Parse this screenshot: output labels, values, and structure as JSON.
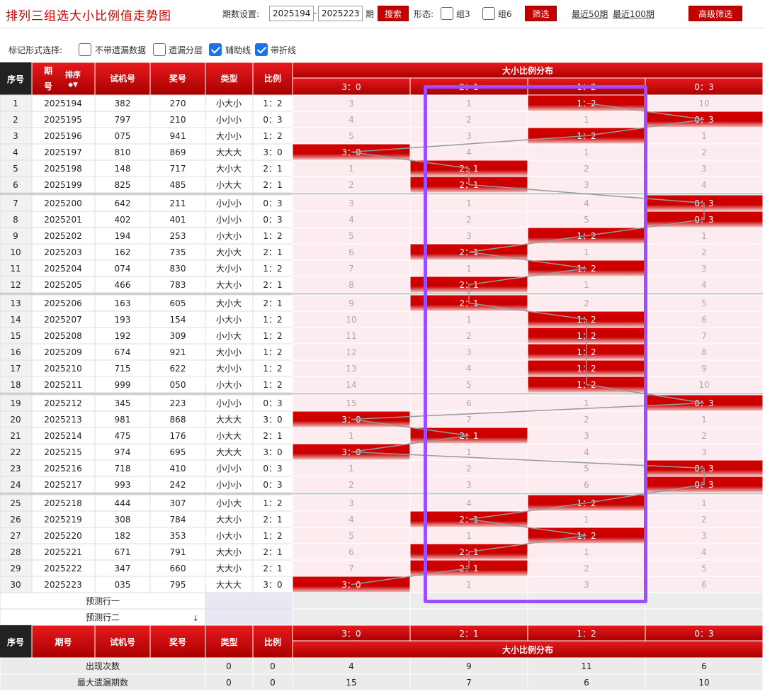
{
  "title": "排列三组选大小比例值走势图",
  "toolbar": {
    "period_label": "期数设置:",
    "from": "2025194",
    "dash": "-",
    "to": "2025223",
    "period_unit": "期",
    "search_label": "搜索",
    "shape_label": "形态:",
    "group3_label": "组3",
    "group6_label": "组6",
    "filter_label": "筛选",
    "recent50_label": "最近50期",
    "recent100_label": "最近100期",
    "advanced_label": "高级筛选"
  },
  "markbar": {
    "label": "标记形式选择:",
    "options": [
      {
        "label": "不带遗漏数据",
        "checked": false
      },
      {
        "label": "遗漏分层",
        "checked": false
      },
      {
        "label": "辅助线",
        "checked": true
      },
      {
        "label": "带折线",
        "checked": true
      }
    ]
  },
  "table": {
    "headers": {
      "seq": "序号",
      "period": "期号",
      "sort": "排序",
      "test": "试机号",
      "draw": "奖号",
      "type": "类型",
      "ratio": "比例",
      "dist": "大小比例分布"
    },
    "dist_columns": [
      "3：0",
      "2：1",
      "1：2",
      "0：3"
    ],
    "rows": [
      {
        "seq": "1",
        "period": "2025194",
        "test": "382",
        "draw": "270",
        "type": "小大小",
        "ratio": "1：2",
        "cells": [
          "3",
          "1",
          "1：2",
          "10"
        ],
        "hit": 2
      },
      {
        "seq": "2",
        "period": "2025195",
        "test": "797",
        "draw": "210",
        "type": "小小小",
        "ratio": "0：3",
        "cells": [
          "4",
          "2",
          "1",
          "0：3"
        ],
        "hit": 3
      },
      {
        "seq": "3",
        "period": "2025196",
        "test": "075",
        "draw": "941",
        "type": "大小小",
        "ratio": "1：2",
        "cells": [
          "5",
          "3",
          "1：2",
          "1"
        ],
        "hit": 2
      },
      {
        "seq": "4",
        "period": "2025197",
        "test": "810",
        "draw": "869",
        "type": "大大大",
        "ratio": "3：0",
        "cells": [
          "3：0",
          "4",
          "1",
          "2"
        ],
        "hit": 0
      },
      {
        "seq": "5",
        "period": "2025198",
        "test": "148",
        "draw": "717",
        "type": "大小大",
        "ratio": "2：1",
        "cells": [
          "1",
          "2：1",
          "2",
          "3"
        ],
        "hit": 1
      },
      {
        "seq": "6",
        "period": "2025199",
        "test": "825",
        "draw": "485",
        "type": "小大大",
        "ratio": "2：1",
        "cells": [
          "2",
          "2：1",
          "3",
          "4"
        ],
        "hit": 1
      },
      {
        "seq": "7",
        "period": "2025200",
        "test": "642",
        "draw": "211",
        "type": "小小小",
        "ratio": "0：3",
        "cells": [
          "3",
          "1",
          "4",
          "0：3"
        ],
        "hit": 3
      },
      {
        "seq": "8",
        "period": "2025201",
        "test": "402",
        "draw": "401",
        "type": "小小小",
        "ratio": "0：3",
        "cells": [
          "4",
          "2",
          "5",
          "0：3"
        ],
        "hit": 3
      },
      {
        "seq": "9",
        "period": "2025202",
        "test": "194",
        "draw": "253",
        "type": "小大小",
        "ratio": "1：2",
        "cells": [
          "5",
          "3",
          "1：2",
          "1"
        ],
        "hit": 2
      },
      {
        "seq": "10",
        "period": "2025203",
        "test": "162",
        "draw": "735",
        "type": "大小大",
        "ratio": "2：1",
        "cells": [
          "6",
          "2：1",
          "1",
          "2"
        ],
        "hit": 1
      },
      {
        "seq": "11",
        "period": "2025204",
        "test": "074",
        "draw": "830",
        "type": "大小小",
        "ratio": "1：2",
        "cells": [
          "7",
          "1",
          "1：2",
          "3"
        ],
        "hit": 2
      },
      {
        "seq": "12",
        "period": "2025205",
        "test": "466",
        "draw": "783",
        "type": "大大小",
        "ratio": "2：1",
        "cells": [
          "8",
          "2：1",
          "1",
          "4"
        ],
        "hit": 1
      },
      {
        "seq": "13",
        "period": "2025206",
        "test": "163",
        "draw": "605",
        "type": "大小大",
        "ratio": "2：1",
        "cells": [
          "9",
          "2：1",
          "2",
          "5"
        ],
        "hit": 1
      },
      {
        "seq": "14",
        "period": "2025207",
        "test": "193",
        "draw": "154",
        "type": "小大小",
        "ratio": "1：2",
        "cells": [
          "10",
          "1",
          "1：2",
          "6"
        ],
        "hit": 2
      },
      {
        "seq": "15",
        "period": "2025208",
        "test": "192",
        "draw": "309",
        "type": "小小大",
        "ratio": "1：2",
        "cells": [
          "11",
          "2",
          "1：2",
          "7"
        ],
        "hit": 2
      },
      {
        "seq": "16",
        "period": "2025209",
        "test": "674",
        "draw": "921",
        "type": "大小小",
        "ratio": "1：2",
        "cells": [
          "12",
          "3",
          "1：2",
          "8"
        ],
        "hit": 2
      },
      {
        "seq": "17",
        "period": "2025210",
        "test": "715",
        "draw": "622",
        "type": "大小小",
        "ratio": "1：2",
        "cells": [
          "13",
          "4",
          "1：2",
          "9"
        ],
        "hit": 2
      },
      {
        "seq": "18",
        "period": "2025211",
        "test": "999",
        "draw": "050",
        "type": "小大小",
        "ratio": "1：2",
        "cells": [
          "14",
          "5",
          "1：2",
          "10"
        ],
        "hit": 2
      },
      {
        "seq": "19",
        "period": "2025212",
        "test": "345",
        "draw": "223",
        "type": "小小小",
        "ratio": "0：3",
        "cells": [
          "15",
          "6",
          "1",
          "0：3"
        ],
        "hit": 3
      },
      {
        "seq": "20",
        "period": "2025213",
        "test": "981",
        "draw": "868",
        "type": "大大大",
        "ratio": "3：0",
        "cells": [
          "3：0",
          "7",
          "2",
          "1"
        ],
        "hit": 0
      },
      {
        "seq": "21",
        "period": "2025214",
        "test": "475",
        "draw": "176",
        "type": "小大大",
        "ratio": "2：1",
        "cells": [
          "1",
          "2：1",
          "3",
          "2"
        ],
        "hit": 1
      },
      {
        "seq": "22",
        "period": "2025215",
        "test": "974",
        "draw": "695",
        "type": "大大大",
        "ratio": "3：0",
        "cells": [
          "3：0",
          "1",
          "4",
          "3"
        ],
        "hit": 0
      },
      {
        "seq": "23",
        "period": "2025216",
        "test": "718",
        "draw": "410",
        "type": "小小小",
        "ratio": "0：3",
        "cells": [
          "1",
          "2",
          "5",
          "0：3"
        ],
        "hit": 3
      },
      {
        "seq": "24",
        "period": "2025217",
        "test": "993",
        "draw": "242",
        "type": "小小小",
        "ratio": "0：3",
        "cells": [
          "2",
          "3",
          "6",
          "0：3"
        ],
        "hit": 3
      },
      {
        "seq": "25",
        "period": "2025218",
        "test": "444",
        "draw": "307",
        "type": "小小大",
        "ratio": "1：2",
        "cells": [
          "3",
          "4",
          "1：2",
          "1"
        ],
        "hit": 2
      },
      {
        "seq": "26",
        "period": "2025219",
        "test": "308",
        "draw": "784",
        "type": "大大小",
        "ratio": "2：1",
        "cells": [
          "4",
          "2：1",
          "1",
          "2"
        ],
        "hit": 1
      },
      {
        "seq": "27",
        "period": "2025220",
        "test": "182",
        "draw": "353",
        "type": "小大小",
        "ratio": "1：2",
        "cells": [
          "5",
          "1",
          "1：2",
          "3"
        ],
        "hit": 2
      },
      {
        "seq": "28",
        "period": "2025221",
        "test": "671",
        "draw": "791",
        "type": "大大小",
        "ratio": "2：1",
        "cells": [
          "6",
          "2：1",
          "1",
          "4"
        ],
        "hit": 1
      },
      {
        "seq": "29",
        "period": "2025222",
        "test": "347",
        "draw": "660",
        "type": "大大小",
        "ratio": "2：1",
        "cells": [
          "7",
          "2：1",
          "2",
          "5"
        ],
        "hit": 1
      },
      {
        "seq": "30",
        "period": "2025223",
        "test": "035",
        "draw": "795",
        "type": "大大大",
        "ratio": "3：0",
        "cells": [
          "3：0",
          "1",
          "3",
          "6"
        ],
        "hit": 0
      }
    ],
    "predict_rows": [
      "预测行一",
      "预测行二"
    ],
    "footer_headers": {
      "seq": "序号",
      "period": "期号",
      "test": "试机号",
      "draw": "奖号",
      "type": "类型",
      "ratio": "比例",
      "dist": "大小比例分布"
    },
    "stats": [
      {
        "label": "出现次数",
        "type": "0",
        "ratio": "0",
        "values": [
          "4",
          "9",
          "11",
          "6"
        ]
      },
      {
        "label": "最大遗漏期数",
        "type": "0",
        "ratio": "0",
        "values": [
          "15",
          "7",
          "6",
          "10"
        ]
      }
    ]
  },
  "colors": {
    "accent": "#c20000",
    "highlight": "#9b4dff",
    "checkbox": "#1a73e8"
  }
}
